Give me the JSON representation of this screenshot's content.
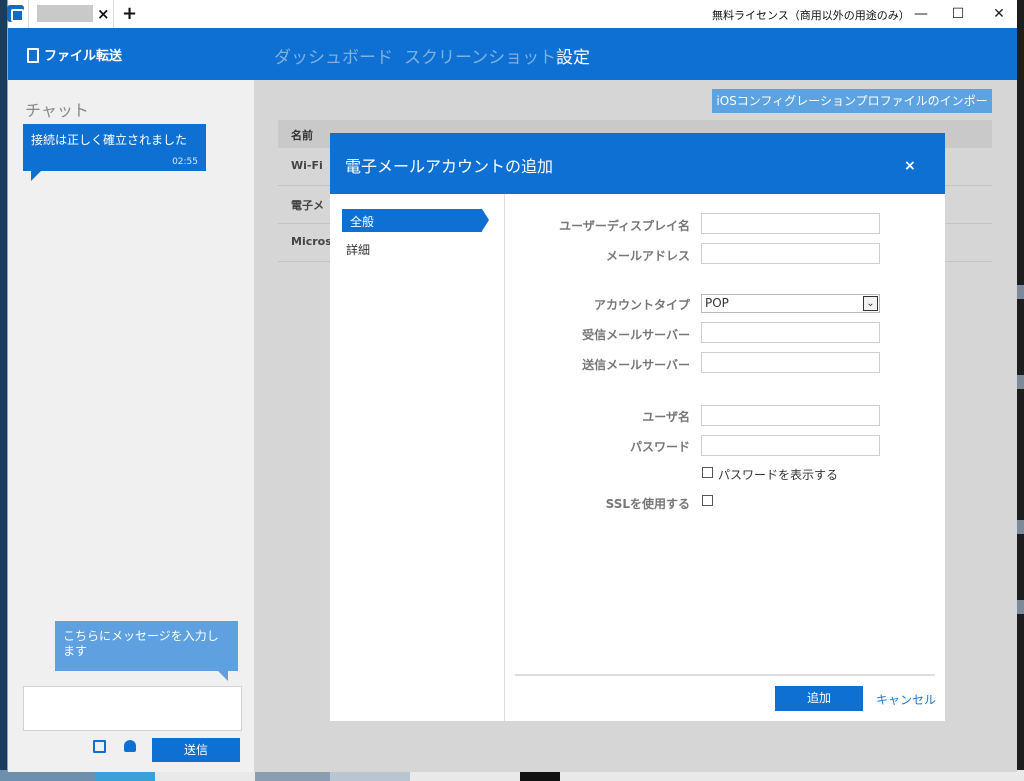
{
  "titlebar": {
    "tab_close": "×",
    "tab_add": "+",
    "license": "無料ライセンス（商用以外の用途のみ）",
    "minimize": "—",
    "maximize": "☐",
    "close": "✕"
  },
  "appbar": {
    "brand": "ファイル転送",
    "nav": [
      "ダッシュボード",
      "スクリーンショット",
      "設定"
    ]
  },
  "chat": {
    "title": "チャット",
    "message": "接続は正しく確立されました",
    "time": "02:55",
    "hint": "こちらにメッセージを入力します",
    "send": "送信"
  },
  "main": {
    "import_button": "iOSコンフィグレーションプロファイルのインポート",
    "table_header": "名前",
    "rows": [
      "Wi-Fi",
      "電子メ",
      "Microso"
    ]
  },
  "modal": {
    "title": "電子メールアカウントの追加",
    "close": "×",
    "side": [
      "全般",
      "詳細"
    ],
    "labels": {
      "display_name": "ユーザーディスプレイ名",
      "email": "メールアドレス",
      "account_type": "アカウントタイプ",
      "incoming": "受信メールサーバー",
      "outgoing": "送信メールサーバー",
      "username": "ユーザ名",
      "password": "パスワード",
      "show_password": "パスワードを表示する",
      "ssl": "SSLを使用する"
    },
    "account_type_value": "POP",
    "add": "追加",
    "cancel": "キャンセル"
  }
}
